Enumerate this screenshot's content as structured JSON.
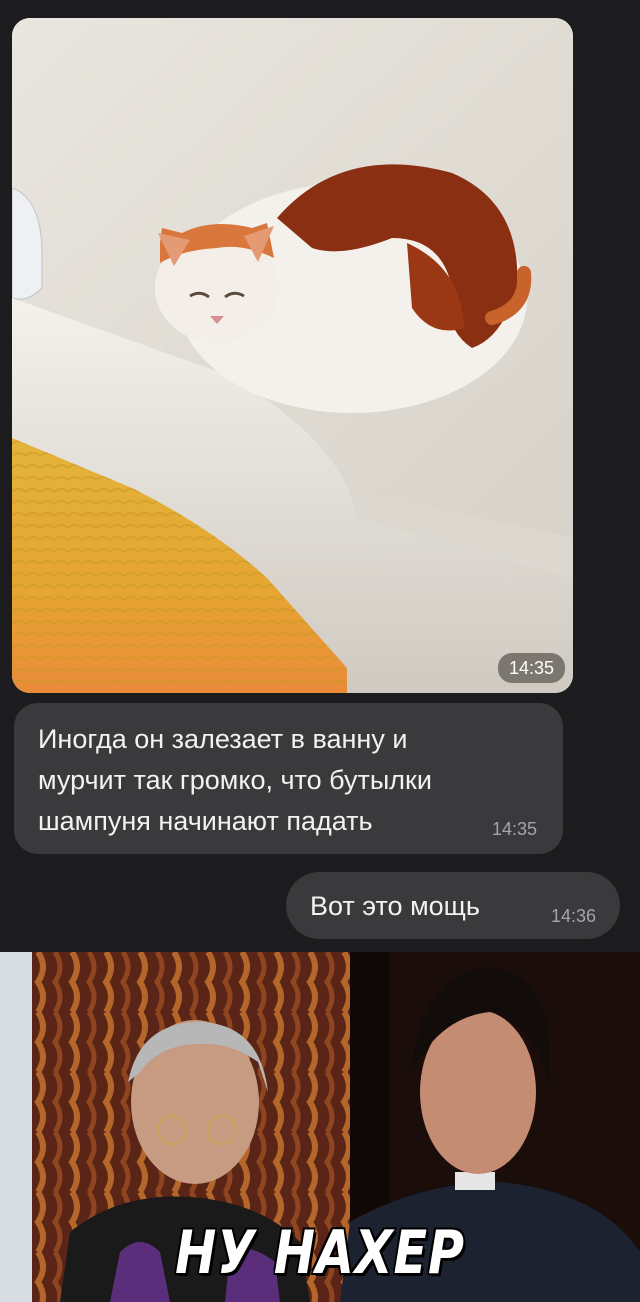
{
  "messages": [
    {
      "type": "photo",
      "direction": "incoming",
      "subject": "cat-in-bathtub",
      "time": "14:35"
    },
    {
      "type": "text",
      "direction": "incoming",
      "text": "Иногда он залезает в ванну и\nмурчит так громко, что бутылки\nшампуня начинают падать",
      "time": "14:35"
    },
    {
      "type": "text",
      "direction": "outgoing",
      "text": "Вот это мощь",
      "time": "14:36"
    }
  ],
  "meme": {
    "caption": "НУ НАХЕР"
  },
  "colors": {
    "background": "#1c1c1e",
    "bubble": "#3a3a3c",
    "text": "#f2f2f2",
    "timestamp": "#a4a4aa"
  }
}
